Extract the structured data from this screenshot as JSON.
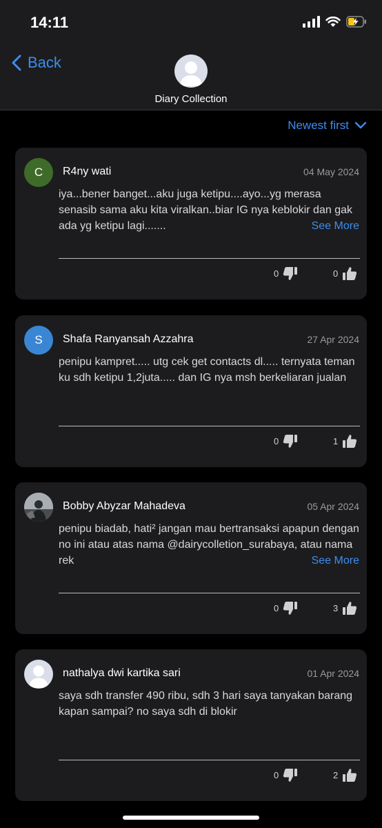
{
  "status": {
    "time": "14:11"
  },
  "header": {
    "back_label": "Back",
    "title": "Diary Collection"
  },
  "sort": {
    "label": "Newest first"
  },
  "see_more_label": "See More",
  "reviews": [
    {
      "initial": "C",
      "avatar_color": "#3f6b2a",
      "name": "R4ny wati",
      "date": "04 May 2024",
      "text": "iya...bener banget...aku juga ketipu....ayo...yg merasa senasib sama aku kita viralkan..biar IG nya keblokir dan gak ada yg ketipu lagi.......",
      "dislikes": "0",
      "likes": "0"
    },
    {
      "initial": "S",
      "avatar_color": "#3a86d4",
      "name": "Shafa Ranyansah Azzahra",
      "date": "27 Apr 2024",
      "text": "penipu kampret..... utg cek get contacts dl..... ternyata teman ku sdh ketipu 1,2juta..... dan IG nya msh berkeliaran jualan",
      "dislikes": "0",
      "likes": "1"
    },
    {
      "name": "Bobby Abyzar Mahadeva",
      "date": "05 Apr 2024",
      "text": "penipu biadab, hati² jangan mau bertransaksi apapun dengan no ini atau atas nama @dairycolletion_surabaya, atau nama rek",
      "dislikes": "0",
      "likes": "3"
    },
    {
      "name": "nathalya dwi kartika sari",
      "date": "01 Apr 2024",
      "text": "saya sdh transfer 490 ribu, sdh 3 hari saya tanyakan barang kapan sampai? no saya sdh di blokir",
      "dislikes": "0",
      "likes": "2"
    }
  ],
  "colors": {
    "accent": "#3b8ef0",
    "card": "#1c1c1e",
    "background": "#000000"
  }
}
